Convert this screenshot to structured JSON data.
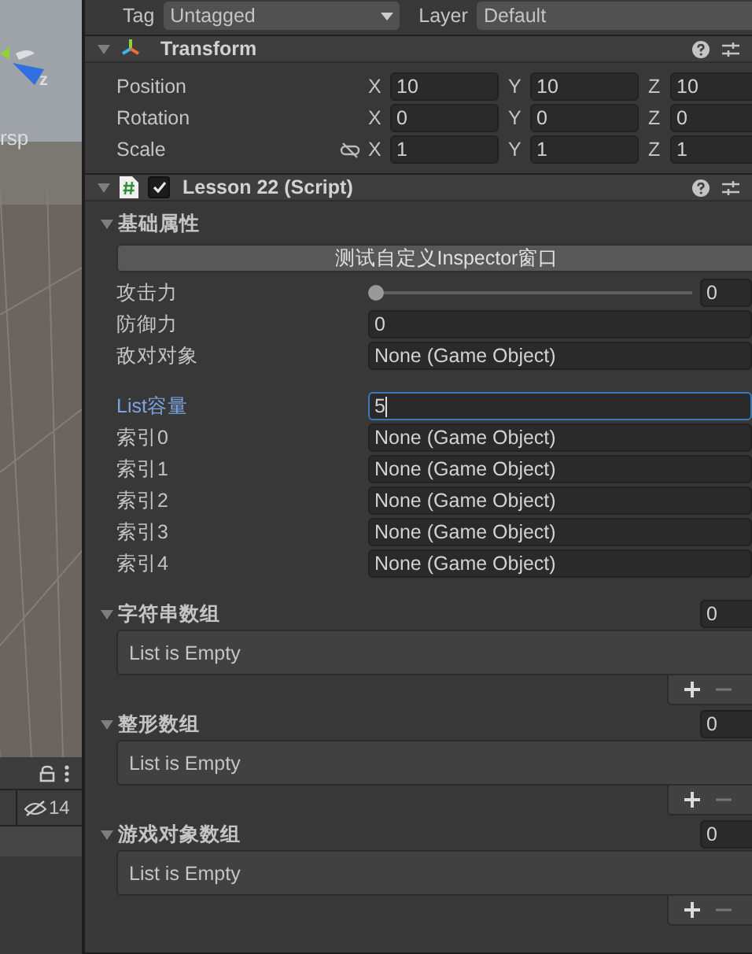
{
  "scene_view": {
    "gizmo_axis": "z",
    "view_label": "rsp"
  },
  "scene_toolbar": {
    "hidden_count": "14"
  },
  "header_row": {
    "tag_label": "Tag",
    "tag_value": "Untagged",
    "layer_label": "Layer",
    "layer_value": "Default"
  },
  "components": [
    {
      "kind": "transform",
      "title": "Transform",
      "expanded": true,
      "rows": [
        {
          "label": "Position",
          "fields": [
            {
              "axis": "X",
              "value": "10"
            },
            {
              "axis": "Y",
              "value": "10"
            },
            {
              "axis": "Z",
              "value": "10"
            }
          ]
        },
        {
          "label": "Rotation",
          "fields": [
            {
              "axis": "X",
              "value": "0"
            },
            {
              "axis": "Y",
              "value": "0"
            },
            {
              "axis": "Z",
              "value": "0"
            }
          ]
        },
        {
          "label": "Scale",
          "fields": [
            {
              "axis": "X",
              "value": "1"
            },
            {
              "axis": "Y",
              "value": "1"
            },
            {
              "axis": "Z",
              "value": "1"
            }
          ]
        }
      ]
    },
    {
      "kind": "script",
      "title": "Lesson 22 (Script)",
      "enabled": true,
      "expanded": true,
      "properties": [
        {
          "kind": "foldout",
          "label": "基础属性",
          "expanded": true
        },
        {
          "kind": "button",
          "label": "测试自定义Inspector窗口"
        },
        {
          "kind": "slider",
          "label": "攻击力",
          "level": 0,
          "value": "0"
        },
        {
          "kind": "int",
          "label": "防御力",
          "value": "0",
          "focused": false
        },
        {
          "kind": "object",
          "label": "敌对对象",
          "value": "None (Game Object)"
        },
        {
          "kind": "space"
        },
        {
          "kind": "int",
          "label": "List容量",
          "value": "5",
          "focused": true
        },
        {
          "kind": "object",
          "label": "索引0",
          "value": "None (Game Object)"
        },
        {
          "kind": "object",
          "label": "索引1",
          "value": "None (Game Object)"
        },
        {
          "kind": "object",
          "label": "索引2",
          "value": "None (Game Object)"
        },
        {
          "kind": "object",
          "label": "索引3",
          "value": "None (Game Object)"
        },
        {
          "kind": "object",
          "label": "索引4",
          "value": "None (Game Object)"
        },
        {
          "kind": "space"
        },
        {
          "kind": "array",
          "label": "字符串数组",
          "expanded": true,
          "size": "0",
          "empty_text": "List is Empty"
        },
        {
          "kind": "array",
          "label": "整形数组",
          "expanded": true,
          "size": "0",
          "empty_text": "List is Empty"
        },
        {
          "kind": "array",
          "label": "游戏对象数组",
          "expanded": true,
          "size": "0",
          "empty_text": "List is Empty"
        }
      ]
    }
  ]
}
